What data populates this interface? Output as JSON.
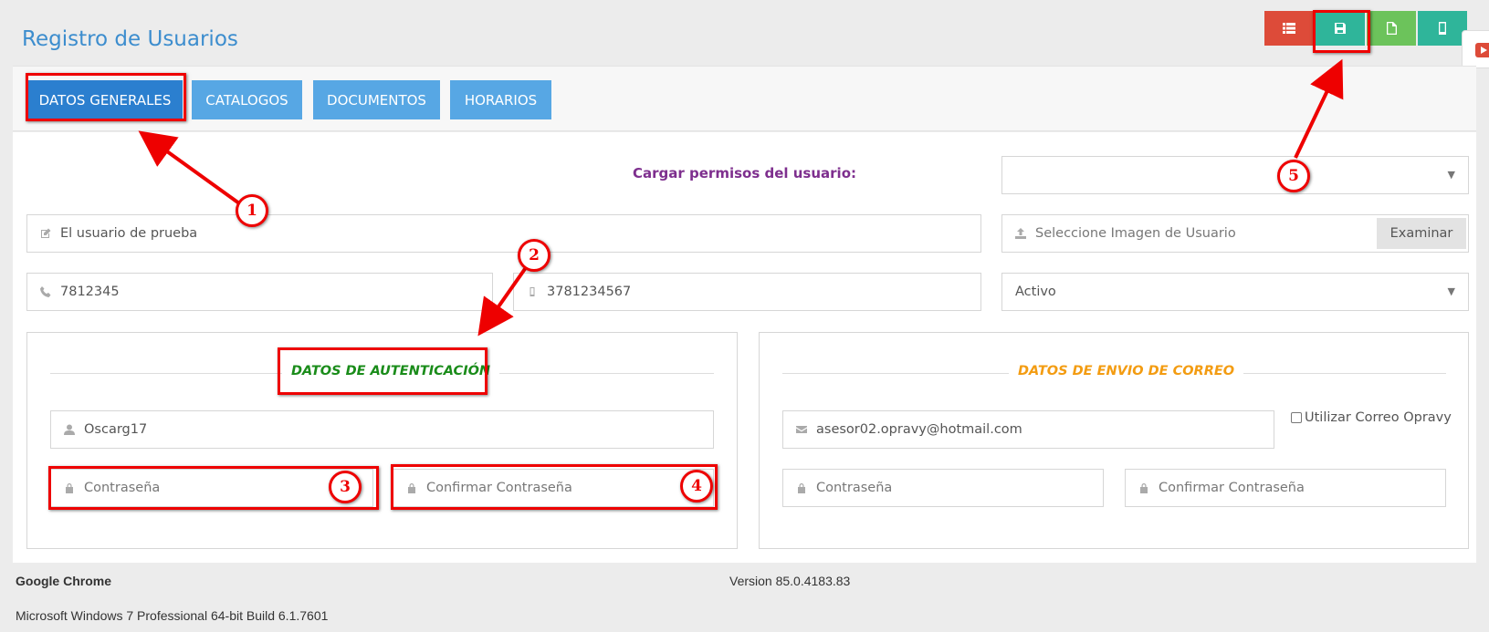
{
  "page": {
    "title": "Registro de Usuarios"
  },
  "toolbar": {
    "actions": [
      {
        "name": "list",
        "icon": "list-icon",
        "color": "#dd4b39"
      },
      {
        "name": "save",
        "icon": "save-icon",
        "color": "#2fb59a"
      },
      {
        "name": "new",
        "icon": "file-icon",
        "color": "#6cc35b"
      },
      {
        "name": "mobile",
        "icon": "mobile-icon",
        "color": "#2fb59a"
      }
    ]
  },
  "tabs": [
    {
      "label": "DATOS GENERALES",
      "active": true
    },
    {
      "label": "CATALOGOS",
      "active": false
    },
    {
      "label": "DOCUMENTOS",
      "active": false
    },
    {
      "label": "HORARIOS",
      "active": false
    }
  ],
  "form": {
    "permissions_label": "Cargar permisos del usuario:",
    "permissions_value": "",
    "user_name": "El usuario de prueba",
    "image_placeholder": "Seleccione Imagen de Usuario",
    "browse_label": "Examinar",
    "phone": "7812345",
    "mobile": "3781234567",
    "status": "Activo"
  },
  "auth": {
    "legend": "DATOS DE AUTENTICACIÓN",
    "legend_color": "#1a8c1a",
    "username": "Oscarg17",
    "password_placeholder": "Contraseña",
    "confirm_placeholder": "Confirmar Contraseña"
  },
  "mail": {
    "legend": "DATOS DE ENVIO DE CORREO",
    "legend_color": "#f39c12",
    "email": "asesor02.opravy@hotmail.com",
    "use_opravy_label": "Utilizar Correo Opravy",
    "password_placeholder": "Contraseña",
    "confirm_placeholder": "Confirmar Contraseña"
  },
  "annotations": [
    "1",
    "2",
    "3",
    "4",
    "5"
  ],
  "footer": {
    "browser": "Google Chrome",
    "version": "Version 85.0.4183.83",
    "os": "Microsoft Windows 7 Professional  64-bit Build 6.1.7601"
  }
}
